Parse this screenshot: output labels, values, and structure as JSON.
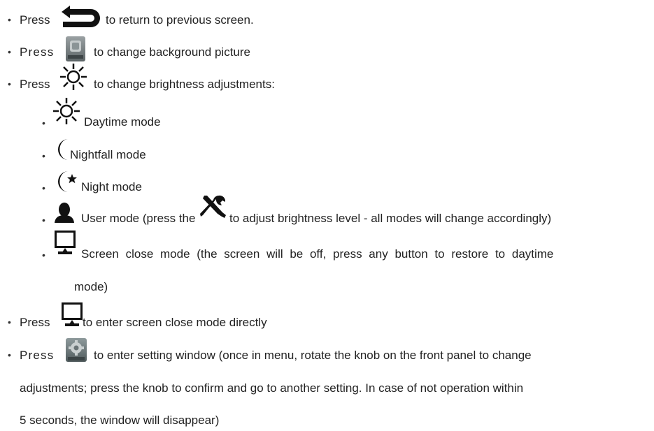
{
  "items": [
    {
      "press": "Press",
      "text": "to return to previous screen."
    },
    {
      "press": "Press",
      "text": "to change background picture",
      "icon_label": "Wallpaper"
    },
    {
      "press": "Press",
      "text": "to change brightness adjustments:"
    },
    {
      "text": "Daytime mode"
    },
    {
      "text": "Nightfall mode"
    },
    {
      "text": "Night mode"
    },
    {
      "text": "User mode (press the",
      "text_after": "to adjust brightness level - all modes will change accordingly)"
    },
    {
      "text": "Screen close mode (the screen will be off, press any button to restore to daytime",
      "text_cont": "mode)"
    },
    {
      "press": "Press",
      "text": "to enter screen close mode directly"
    },
    {
      "press": "Press",
      "text": "to enter setting window (once in menu, rotate the knob on the front panel to change",
      "icon_label": "Setup",
      "text_cont1": "adjustments; press the knob to confirm and go to another setting. In case of not operation within",
      "text_cont2": "5 seconds, the window will disappear)"
    }
  ],
  "icons": {
    "back": "return-arrow-icon",
    "wallpaper": "wallpaper-icon",
    "brightness": "sun-icon",
    "day": "sun-icon",
    "nightfall": "crescent-moon-icon",
    "night": "moon-star-icon",
    "user": "user-icon",
    "tools": "wrench-screwdriver-icon",
    "screen": "monitor-icon",
    "setup": "gear-icon"
  }
}
